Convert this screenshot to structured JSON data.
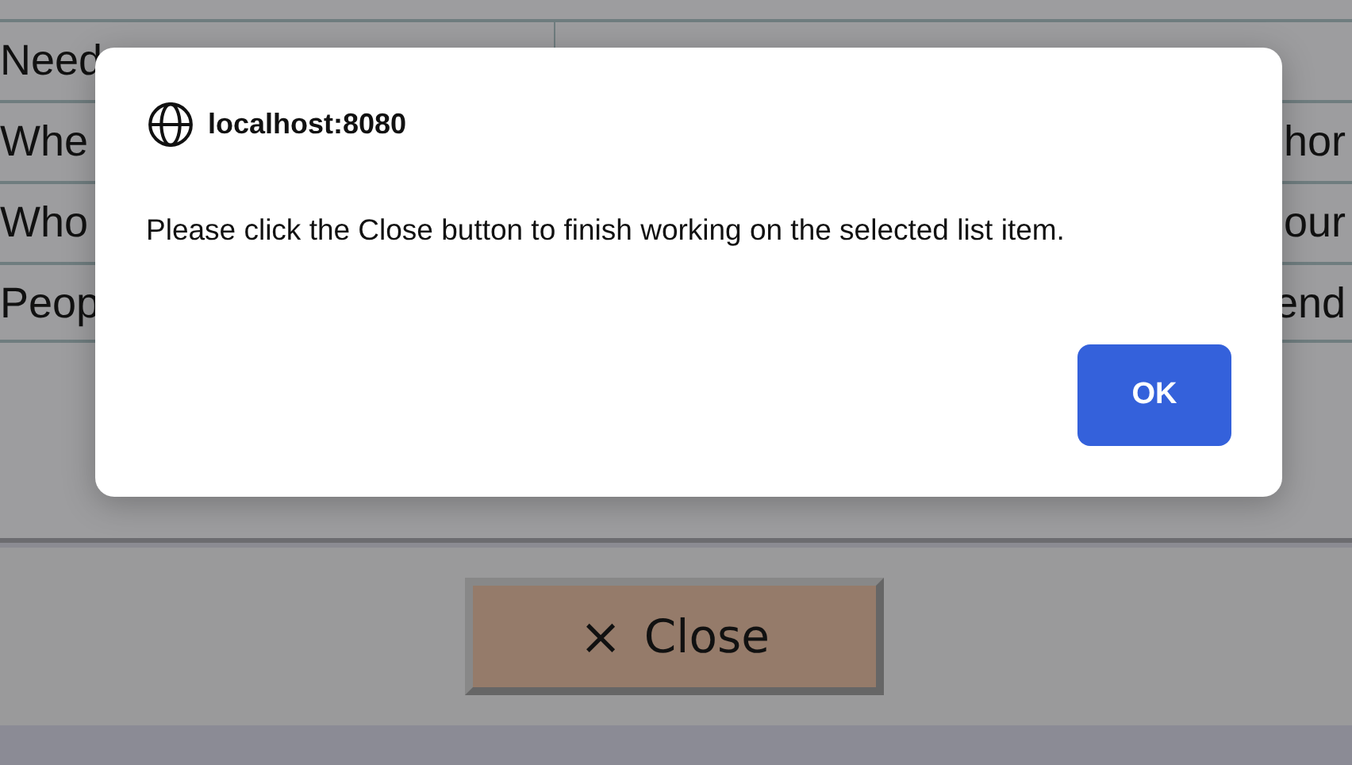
{
  "table": {
    "rows": [
      {
        "column_1": "Need"
      },
      {
        "column_1": "Whe",
        "column_2": "hor"
      },
      {
        "column_1": "Who",
        "column_2": "our"
      },
      {
        "column_1": "Peop",
        "column_2": "end"
      }
    ]
  },
  "footer": {
    "close_button": {
      "icon": "×",
      "label": "Close"
    }
  },
  "dialog": {
    "title": "localhost:8080",
    "message": "Please click the Close button to finish working on the selected list item.",
    "buttons": [
      "OK"
    ]
  }
}
